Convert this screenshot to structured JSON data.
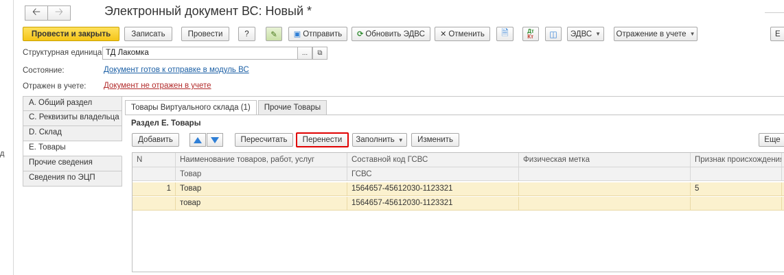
{
  "header": {
    "title": "Электронный документ ВС: Новый *",
    "back_icon": "arrow-left-icon",
    "forward_icon": "arrow-right-icon"
  },
  "toolbar": {
    "post_close": "Провести и закрыть",
    "save": "Записать",
    "post": "Провести",
    "help": "?",
    "send": "Отправить",
    "refresh_edvs": "Обновить ЭДВС",
    "cancel": "Отменить",
    "edvs_menu": "ЭДВС",
    "accounting_menu": "Отражение в учете",
    "more_cut": "Е"
  },
  "fields": {
    "unit_label": "Структурная единица:",
    "unit_value": "ТД Лакомка",
    "unit_select": "...",
    "unit_open": "⧉",
    "state_label": "Состояние:",
    "state_value": "Документ готов к отправке в модуль ВС",
    "accounting_label": "Отражен в учете:",
    "accounting_value": "Документ не отражен в учете"
  },
  "sections": [
    {
      "label": "А. Общий раздел",
      "active": false
    },
    {
      "label": "С. Реквизиты владельца",
      "active": false
    },
    {
      "label": "D. Склад",
      "active": false
    },
    {
      "label": "Е. Товары",
      "active": true
    },
    {
      "label": "Прочие сведения",
      "active": false
    },
    {
      "label": "Сведения по ЭЦП",
      "active": false
    }
  ],
  "tabs": [
    {
      "label": "Товары Виртуального склада (1)",
      "active": true
    },
    {
      "label": "Прочие Товары",
      "active": false
    }
  ],
  "section_title": "Раздел Е. Товары",
  "table_toolbar": {
    "add": "Добавить",
    "recalc": "Пересчитать",
    "transfer": "Перенести",
    "fill": "Заполнить",
    "edit": "Изменить",
    "more": "Еще"
  },
  "table": {
    "headers_row1": [
      "N",
      "Наименование товаров, работ, услуг",
      "Составной код ГСВС",
      "Физическая метка",
      "Признак происхождения"
    ],
    "headers_row2": [
      "",
      "Товар",
      "ГСВС",
      "",
      ""
    ],
    "rows": [
      {
        "n": "1",
        "name": "Товар",
        "code": "1564657-45612030-1123321",
        "mark": "",
        "origin": "5"
      },
      {
        "n": "",
        "name": "товар",
        "code": "1564657-45612030-1123321",
        "mark": "",
        "origin": ""
      }
    ]
  },
  "left_edge_text": "д",
  "colors": {
    "primary": "#f5c518",
    "link": "#1b5fa5",
    "link_alert": "#b22a2a",
    "row_highlight": "#fbf1ce",
    "focus_outline": "#e00000"
  }
}
